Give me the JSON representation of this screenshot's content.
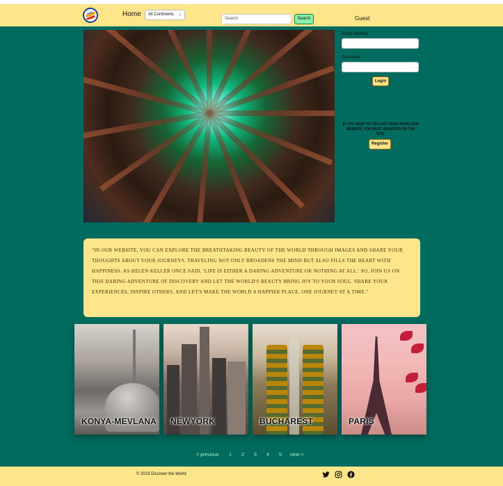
{
  "header": {
    "home_label": "Home",
    "continent_selected": "All Continents",
    "search_placeholder": "Search",
    "search_button": "Search",
    "user_label": "Guest"
  },
  "login": {
    "email_label": "Email address",
    "password_label": "Password",
    "login_button": "Login",
    "register_note": "IF YOU WANT TO UPLOAD ITEMS FROM OUR WEBSITE, YOU MUST REGISTER ON THE SITE.",
    "register_button": "Register"
  },
  "quote": {
    "text": "\"In our website, you can explore the breathtaking beauty of the world through images and share your thoughts about your journeys. Traveling not only broadens the mind but also fills the heart with happiness. As Helen Keller once said, 'Life is either a daring adventure or nothing at all.' So, join us on this daring adventure of discovery and let the world's beauty bring joy to your soul. Share your experiences, inspire others, and let's make the world a happier place, one journey at a time.\""
  },
  "cities": [
    {
      "name": "KONYA-MEVLANA"
    },
    {
      "name": "NEWYORK"
    },
    {
      "name": "BUCHAREST"
    },
    {
      "name": "PARIS"
    }
  ],
  "pagination": {
    "previous": "< previous",
    "pages": [
      "1",
      "2",
      "3",
      "4",
      "5"
    ],
    "next": "next >"
  },
  "footer": {
    "copyright": "© 2023 Discover the World"
  },
  "icons": {
    "twitter": "twitter-icon",
    "instagram": "instagram-icon",
    "facebook": "facebook-icon"
  },
  "colors": {
    "header_bg": "#fde68a",
    "main_bg": "#006b5e",
    "search_button": "#86efac"
  }
}
